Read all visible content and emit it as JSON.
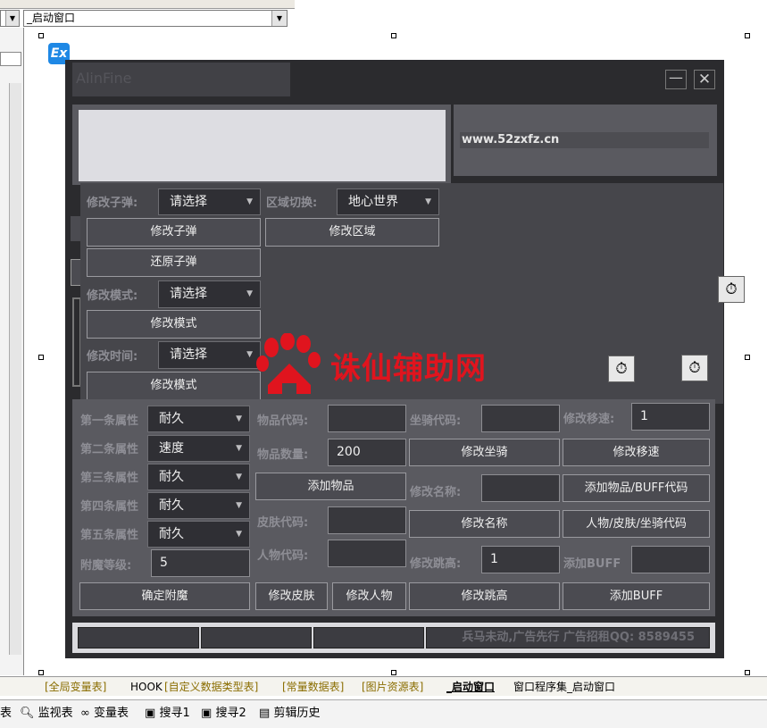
{
  "ide": {
    "form_selector_value": "_启动窗口",
    "tabs": [
      "[全局变量表]",
      "HOOK",
      "[自定义数据类型表]",
      "[常量数据表]",
      "[图片资源表]",
      "_启动窗口",
      "窗口程序集_启动窗口"
    ],
    "status_items": [
      "表",
      "监视表",
      "变量表",
      "搜寻1",
      "搜寻2",
      "剪辑历史"
    ],
    "ex_badge": "Ex"
  },
  "app": {
    "title": "AlinFine",
    "website": "www.52zxfz.cn",
    "watermark": "诛仙辅助网",
    "ammo": {
      "label": "修改子弹:",
      "select_value": "请选择",
      "modify_btn": "修改子弹",
      "restore_btn": "还原子弹"
    },
    "region": {
      "label": "区域切换:",
      "select_value": "地心世界",
      "modify_btn": "修改区域"
    },
    "mode": {
      "label": "修改模式:",
      "select_value": "请选择",
      "modify_btn": "修改模式"
    },
    "time": {
      "label": "修改时间:",
      "select_value": "请选择",
      "modify_btn": "修改模式"
    },
    "attributes": [
      {
        "label": "第一条属性",
        "value": "耐久"
      },
      {
        "label": "第二条属性",
        "value": "速度"
      },
      {
        "label": "第三条属性",
        "value": "耐久"
      },
      {
        "label": "第四条属性",
        "value": "耐久"
      },
      {
        "label": "第五条属性",
        "value": "耐久"
      }
    ],
    "enchant_label": "附魔等级:",
    "enchant_value": "5",
    "enchant_btn": "确定附魔",
    "item_code_label": "物品代码:",
    "item_code_value": "",
    "item_qty_label": "物品数量:",
    "item_qty_value": "200",
    "add_item_btn": "添加物品",
    "skin_code_label": "皮肤代码:",
    "skin_code_value": "",
    "char_code_label": "人物代码:",
    "char_code_value": "",
    "modify_skin_btn": "修改皮肤",
    "modify_char_btn": "修改人物",
    "mount_code_label": "坐骑代码:",
    "mount_code_value": "",
    "modify_mount_btn": "修改坐骑",
    "rename_label": "修改名称:",
    "rename_value": "",
    "rename_btn": "修改名称",
    "jump_label": "修改跳高:",
    "jump_value": "1",
    "jump_btn": "修改跳高",
    "speed_label": "修改移速:",
    "speed_value": "1",
    "speed_btn": "修改移速",
    "item_buff_code_btn": "添加物品/BUFF代码",
    "char_skin_mount_code_btn": "人物/皮肤/坐骑代码",
    "add_buff_label": "添加BUFF",
    "add_buff_value": "",
    "add_buff_btn": "添加BUFF",
    "footer_text": "兵马未动,广告先行  广告招租QQ:  8589455"
  }
}
